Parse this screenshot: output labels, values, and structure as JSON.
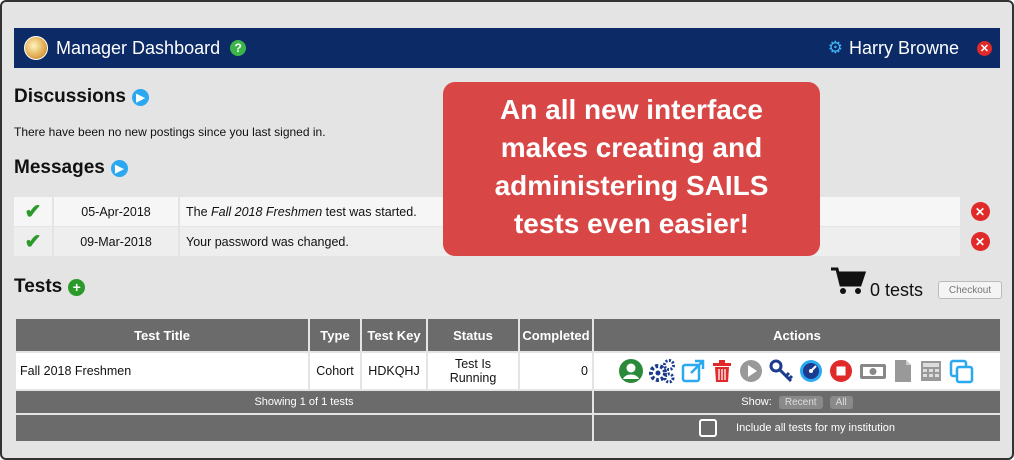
{
  "header": {
    "title": "Manager Dashboard",
    "help": "?",
    "user": "Harry Browne"
  },
  "discussions": {
    "title": "Discussions",
    "text": "There have been no new postings since you last signed in."
  },
  "messages": {
    "title": "Messages",
    "rows": [
      {
        "date": "05-Apr-2018",
        "pre": "The ",
        "em": "Fall 2018 Freshmen",
        "post": " test was started."
      },
      {
        "date": "09-Mar-2018",
        "pre": "Your password was changed.",
        "em": "",
        "post": ""
      }
    ]
  },
  "callout": {
    "line1": "An all new interface",
    "line2": "makes creating and",
    "line3": "administering SAILS",
    "line4": "tests even easier!"
  },
  "tests": {
    "title": "Tests",
    "cart_count": "0 tests",
    "checkout": "Checkout",
    "columns": [
      "Test Title",
      "Type",
      "Test Key",
      "Status",
      "Completed",
      "Actions"
    ],
    "rows": [
      {
        "title": "Fall 2018 Freshmen",
        "type": "Cohort",
        "key": "HDKQHJ",
        "status_l1": "Test Is",
        "status_l2": "Running",
        "completed": "0"
      }
    ],
    "showing": "Showing 1 of 1 tests",
    "show_label": "Show:",
    "filter_recent": "Recent",
    "filter_all": "All",
    "include_all": "Include all tests for my institution"
  },
  "colors": {
    "navy": "#0b2a66",
    "callout": "#d84646",
    "green": "#2a9a2a",
    "blue": "#2aa8f0",
    "red": "#e02a2a",
    "header_gray": "#6b6b6b"
  },
  "icons": [
    "user-icon",
    "gears-icon",
    "external-link-icon",
    "trash-icon",
    "play-icon",
    "key-icon",
    "gauge-icon",
    "stop-icon",
    "money-icon",
    "document-icon",
    "calculator-icon",
    "copy-icon"
  ]
}
